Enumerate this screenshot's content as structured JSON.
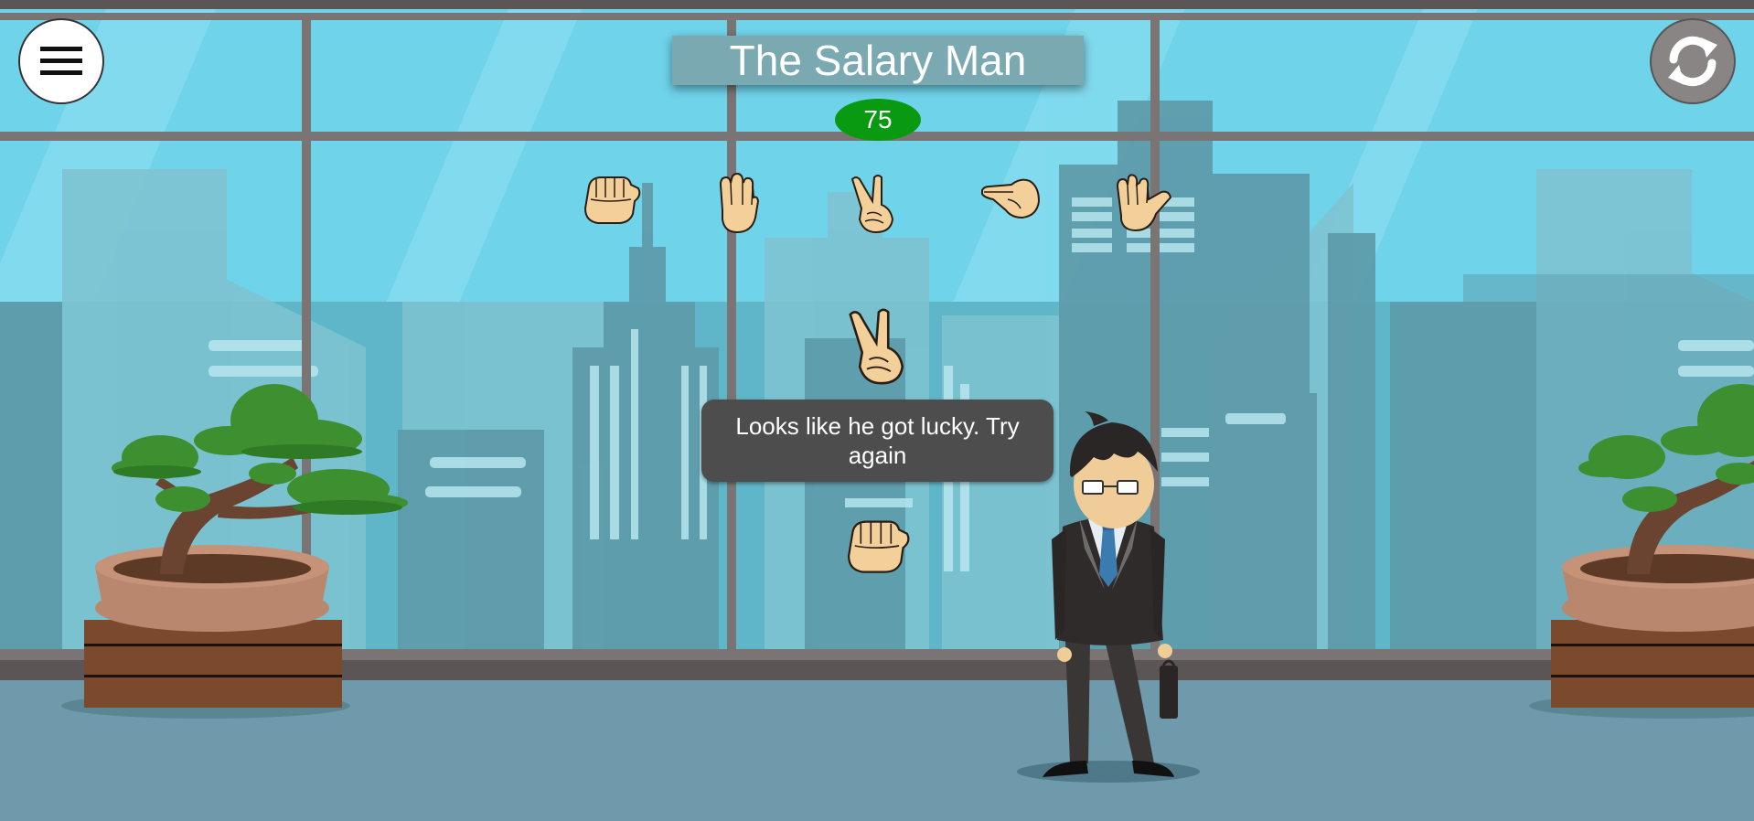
{
  "game": {
    "title": "The Salary Man",
    "score": "75",
    "message": "Looks like he got lucky. Try again"
  },
  "choices": [
    {
      "name": "rock",
      "icon": "fist-hand-icon"
    },
    {
      "name": "paper",
      "icon": "open-hand-icon"
    },
    {
      "name": "scissors",
      "icon": "scissors-hand-icon"
    },
    {
      "name": "lizard",
      "icon": "lizard-hand-icon"
    },
    {
      "name": "spock",
      "icon": "spock-hand-icon"
    }
  ],
  "opponent_choice": {
    "name": "scissors",
    "icon": "scissors-hand-icon"
  },
  "player_choice": {
    "name": "rock",
    "icon": "fist-hand-icon"
  },
  "colors": {
    "sky": "#6fd3ea",
    "score_badge": "#0a9a12",
    "title_box": "#7aa9b1",
    "message_box": "#4d4d4d",
    "floor": "#6e9aab"
  }
}
